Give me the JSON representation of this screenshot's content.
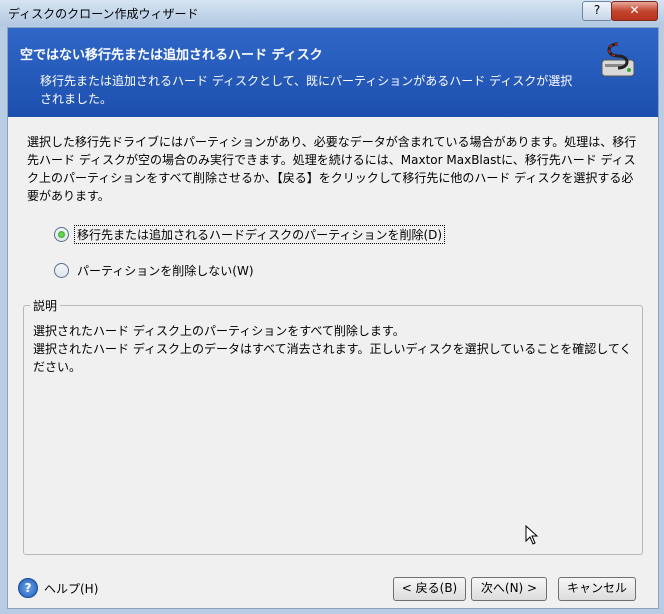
{
  "window": {
    "title": "ディスクのクローン作成ウィザード",
    "help_button": "?",
    "close_button": "✕"
  },
  "header": {
    "title": "空ではない移行先または追加されるハード ディスク",
    "subtitle": "移行先または追加されるハード ディスクとして、既にパーティションがあるハード ディスクが選択されました。"
  },
  "body": {
    "text": "選択した移行先ドライブにはパーティションがあり、必要なデータが含まれている場合があります。処理は、移行先ハード ディスクが空の場合のみ実行できます。処理を続けるには、Maxtor MaxBlastに、移行先ハード ディスク上のパーティションをすべて削除させるか、【戻る】をクリックして移行先に他のハード ディスクを選択する必要があります。"
  },
  "options": {
    "delete_label": "移行先または追加されるハードディスクのパーティションを削除(D)",
    "keep_label": "パーティションを削除しない(W)",
    "selected": "delete"
  },
  "description": {
    "legend": "説明",
    "line1": "選択されたハード ディスク上のパーティションをすべて削除します。",
    "line2": "選択されたハード ディスク上のデータはすべて消去されます。正しいディスクを選択していることを確認してください。"
  },
  "footer": {
    "help": "ヘルプ(H)",
    "back": "< 戻る(B)",
    "next": "次へ(N) >",
    "cancel": "キャンセル"
  }
}
